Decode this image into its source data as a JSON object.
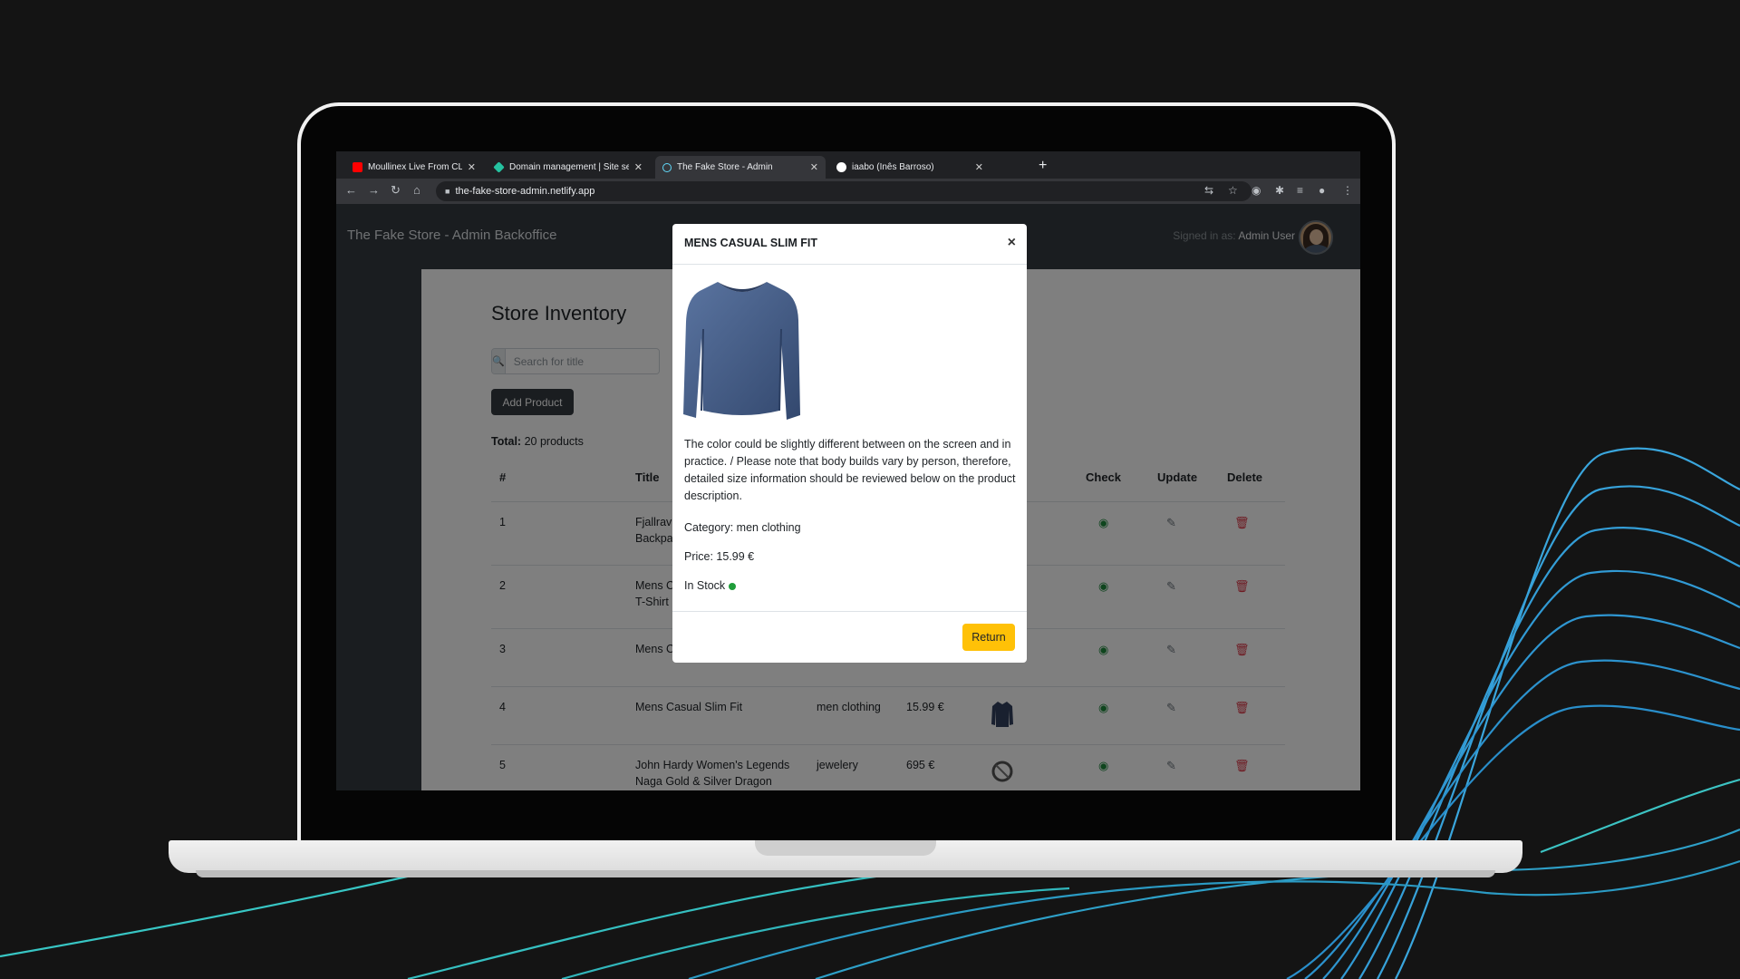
{
  "browser": {
    "tabs": [
      {
        "title": "Moullinex Live From CLARA",
        "favicon_color": "#ff0000",
        "has_audio": true
      },
      {
        "title": "Domain management | Site set",
        "favicon_color": "#25c2a0"
      },
      {
        "title": "The Fake Store - Admin",
        "favicon_color": "#61dafb",
        "active": true
      },
      {
        "title": "iaabo (Inês Barroso)",
        "favicon_color": "#ffffff"
      }
    ],
    "url": "the-fake-store-admin.netlify.app"
  },
  "app": {
    "brand": "The Fake Store - Admin Backoffice",
    "signed_in_label": "Signed in as:",
    "user_name": "Admin User"
  },
  "inventory": {
    "title": "Store Inventory",
    "search_placeholder": "Search for title",
    "add_button": "Add Product",
    "total_label": "Total:",
    "total_value": "20 products",
    "columns": [
      "#",
      "Title",
      "Check",
      "Update",
      "Delete"
    ],
    "rows": [
      {
        "id": "1",
        "title_line1": "Fjallrav",
        "title_line2": "Backpa",
        "category": "",
        "price": ""
      },
      {
        "id": "2",
        "title_line1": "Mens C",
        "title_line2": "T-Shirt",
        "category": "",
        "price": ""
      },
      {
        "id": "3",
        "title_line1": "Mens C",
        "title_line2": "",
        "category": "",
        "price": ""
      },
      {
        "id": "4",
        "title_line1": "Mens Casual Slim Fit",
        "title_line2": "",
        "category": "men clothing",
        "price": "15.99 €"
      },
      {
        "id": "5",
        "title_line1": "John Hardy Women's Legends",
        "title_line2": "Naga Gold & Silver Dragon",
        "category": "jewelery",
        "price": "695 €"
      }
    ]
  },
  "modal": {
    "title": "MENS CASUAL SLIM FIT",
    "close": "×",
    "description": "The color could be slightly different between on the screen and in practice. / Please note that body builds vary by person, therefore, detailed size information should be reviewed below on the product description.",
    "category": "Category: men clothing",
    "price": "Price: 15.99 €",
    "stock": "In Stock",
    "stock_color": "#1f9d3a",
    "return_button": "Return",
    "return_color": "#ffc107"
  },
  "colors": {
    "background": "#141414",
    "wave_lines": "#35a8e0",
    "navbar": "#343a40"
  }
}
